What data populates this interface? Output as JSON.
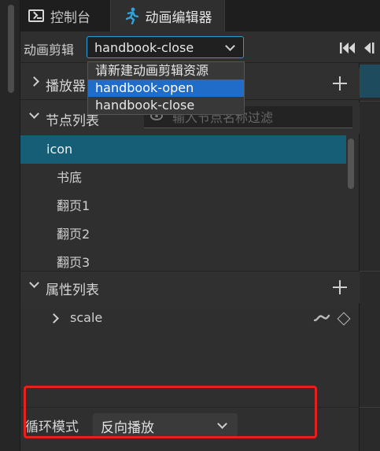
{
  "tabs": {
    "console_label": "控制台",
    "animation_editor_label": "动画编辑器"
  },
  "clip": {
    "label": "动画剪辑",
    "selected_value": "handbook-close",
    "options": [
      "请新建动画剪辑资源",
      "handbook-open",
      "handbook-close"
    ],
    "highlighted_option": "handbook-open"
  },
  "players": {
    "label": "播放器"
  },
  "nodes": {
    "label": "节点列表",
    "filter_placeholder": "输入节点名称过滤",
    "items": [
      "icon",
      "书底",
      "翻页1",
      "翻页2",
      "翻页3"
    ],
    "selected": "icon"
  },
  "properties": {
    "label": "属性列表",
    "items": [
      "scale"
    ]
  },
  "loop_mode": {
    "label": "循环模式",
    "value": "反向播放"
  },
  "colors": {
    "accent_blue": "#1f6cc9",
    "selected_row": "#155e76",
    "highlight_red": "#e52020",
    "runner_icon": "#2fa3d8"
  },
  "icons": [
    "terminal-icon",
    "running-figure-icon",
    "chevron-down-icon",
    "first-frame-icon",
    "prev-frame-icon",
    "chevron-right-icon",
    "plus-icon",
    "eye-icon",
    "curve-icon",
    "keyframe-diamond-icon"
  ]
}
